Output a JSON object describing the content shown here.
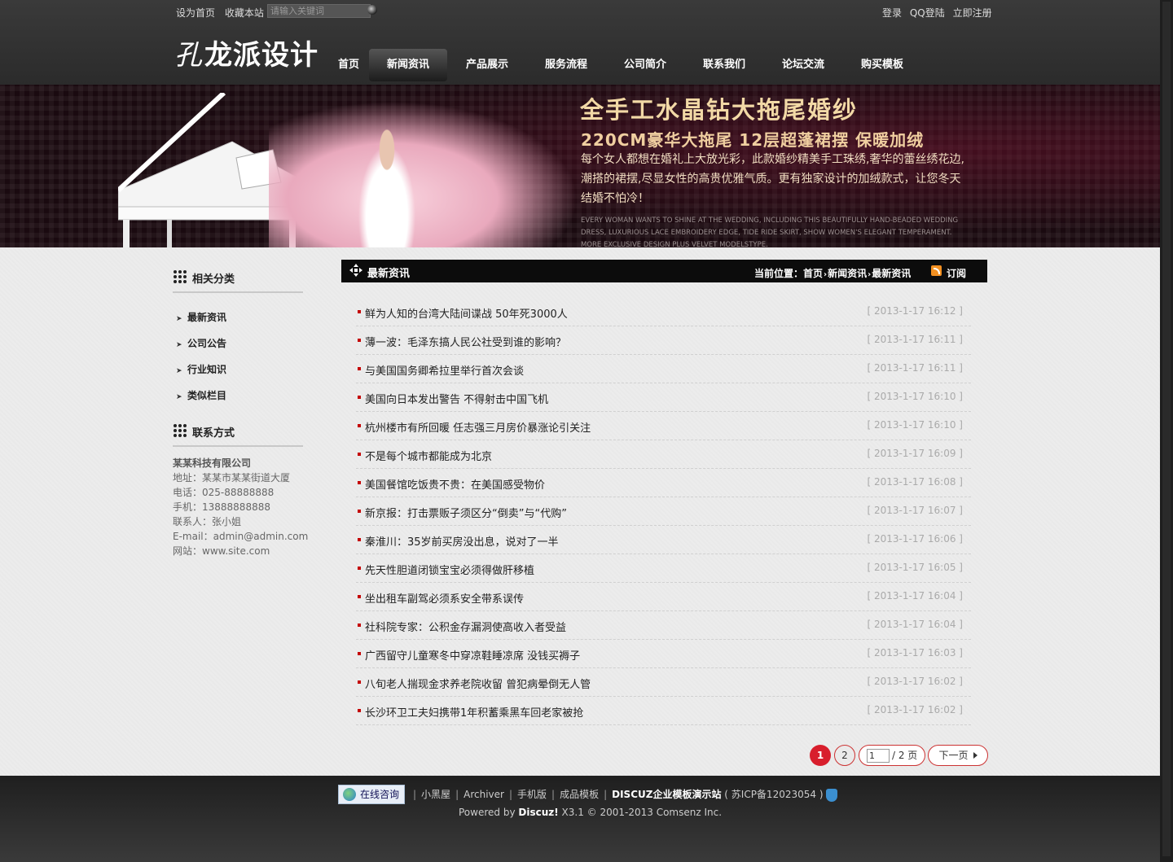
{
  "topbar": {
    "left_links": [
      "设为首页",
      "收藏本站"
    ],
    "search_placeholder": "请输入关键词",
    "right_links": [
      "登录",
      "QQ登陆",
      "立即注册"
    ]
  },
  "logo": {
    "mark": "孔",
    "text": "龙派设计"
  },
  "nav": {
    "items": [
      "首页",
      "新闻资讯",
      "产品展示",
      "服务流程",
      "公司简介",
      "联系我们",
      "论坛交流",
      "购买模板"
    ],
    "active_index": 1
  },
  "banner": {
    "title": "全手工水晶钻大拖尾婚纱",
    "subtitle": "220CM豪华大拖尾 12层超蓬裙摆 保暖加绒",
    "description": "每个女人都想在婚礼上大放光彩，此款婚纱精美手工珠绣,奢华的蕾丝绣花边,潮搭的裙摆,尽显女性的高贵优雅气质。更有独家设计的加绒款式，让您冬天结婚不怕冷！",
    "english": "EVERY WOMAN WANTS TO SHINE AT THE WEDDING, INCLUDING THIS BEAUTIFULLY HAND-BEADED WEDDING DRESS, LUXURIOUS LACE EMBROIDERY EDGE, TIDE RIDE SKIRT, SHOW WOMEN'S ELEGANT TEMPERAMENT. MORE EXCLUSIVE DESIGN PLUS VELVET MODELSTYPE."
  },
  "sidebar": {
    "categories_title": "相关分类",
    "categories": [
      "最新资讯",
      "公司公告",
      "行业知识",
      "类似栏目"
    ],
    "contact_title": "联系方式",
    "contact": {
      "company": "某某科技有限公司",
      "address": "地址：某某市某某街道大厦",
      "phone": "电话：025-88888888",
      "mobile": "手机：13888888888",
      "person": "联系人：张小姐",
      "email": "E-mail：admin@admin.com",
      "site": "网站：www.site.com"
    }
  },
  "main": {
    "title": "最新资讯",
    "breadcrumb_label": "当前位置：",
    "breadcrumb": [
      "首页",
      "新闻资讯",
      "最新资讯"
    ],
    "subscribe": "订阅",
    "articles": [
      {
        "title": "鲜为人知的台湾大陆间谍战 50年死3000人",
        "date": "[ 2013-1-17 16:12 ]"
      },
      {
        "title": "薄一波：毛泽东搞人民公社受到谁的影响？",
        "date": "[ 2013-1-17 16:11 ]"
      },
      {
        "title": "与美国国务卿希拉里举行首次会谈",
        "date": "[ 2013-1-17 16:11 ]"
      },
      {
        "title": "美国向日本发出警告 不得射击中国飞机",
        "date": "[ 2013-1-17 16:10 ]"
      },
      {
        "title": "杭州楼市有所回暖 任志强三月房价暴涨论引关注",
        "date": "[ 2013-1-17 16:10 ]"
      },
      {
        "title": "不是每个城市都能成为北京",
        "date": "[ 2013-1-17 16:09 ]"
      },
      {
        "title": "美国餐馆吃饭贵不贵：在美国感受物价",
        "date": "[ 2013-1-17 16:08 ]"
      },
      {
        "title": "新京报：打击票贩子须区分“倒卖”与“代购”",
        "date": "[ 2013-1-17 16:07 ]"
      },
      {
        "title": "秦淮川：35岁前买房没出息，说对了一半",
        "date": "[ 2013-1-17 16:06 ]"
      },
      {
        "title": "先天性胆道闭锁宝宝必须得做肝移植",
        "date": "[ 2013-1-17 16:05 ]"
      },
      {
        "title": "坐出租车副驾必须系安全带系误传",
        "date": "[ 2013-1-17 16:04 ]"
      },
      {
        "title": "社科院专家：公积金存漏洞使高收入者受益",
        "date": "[ 2013-1-17 16:04 ]"
      },
      {
        "title": "广西留守儿童寒冬中穿凉鞋睡凉席 没钱买褥子",
        "date": "[ 2013-1-17 16:03 ]"
      },
      {
        "title": "八旬老人揣现金求养老院收留 曾犯病晕倒无人管",
        "date": "[ 2013-1-17 16:02 ]"
      },
      {
        "title": "长沙环卫工夫妇携带1年积蓄乘黑车回老家被抢",
        "date": "[ 2013-1-17 16:02 ]"
      }
    ]
  },
  "pager": {
    "current": "1",
    "page2": "2",
    "input_value": "1",
    "total": "/ 2 页",
    "next": "下一页"
  },
  "footer": {
    "online": "在线咨询",
    "links": [
      "小黑屋",
      "Archiver",
      "手机版",
      "成品模板"
    ],
    "site_name": "DISCUZ企业模板演示站",
    "icp": "( 苏ICP备12023054 )",
    "powered_prefix": "Powered by ",
    "powered_brand": "Discuz!",
    "powered_suffix": " X3.1 © 2001-2013 Comsenz Inc."
  }
}
